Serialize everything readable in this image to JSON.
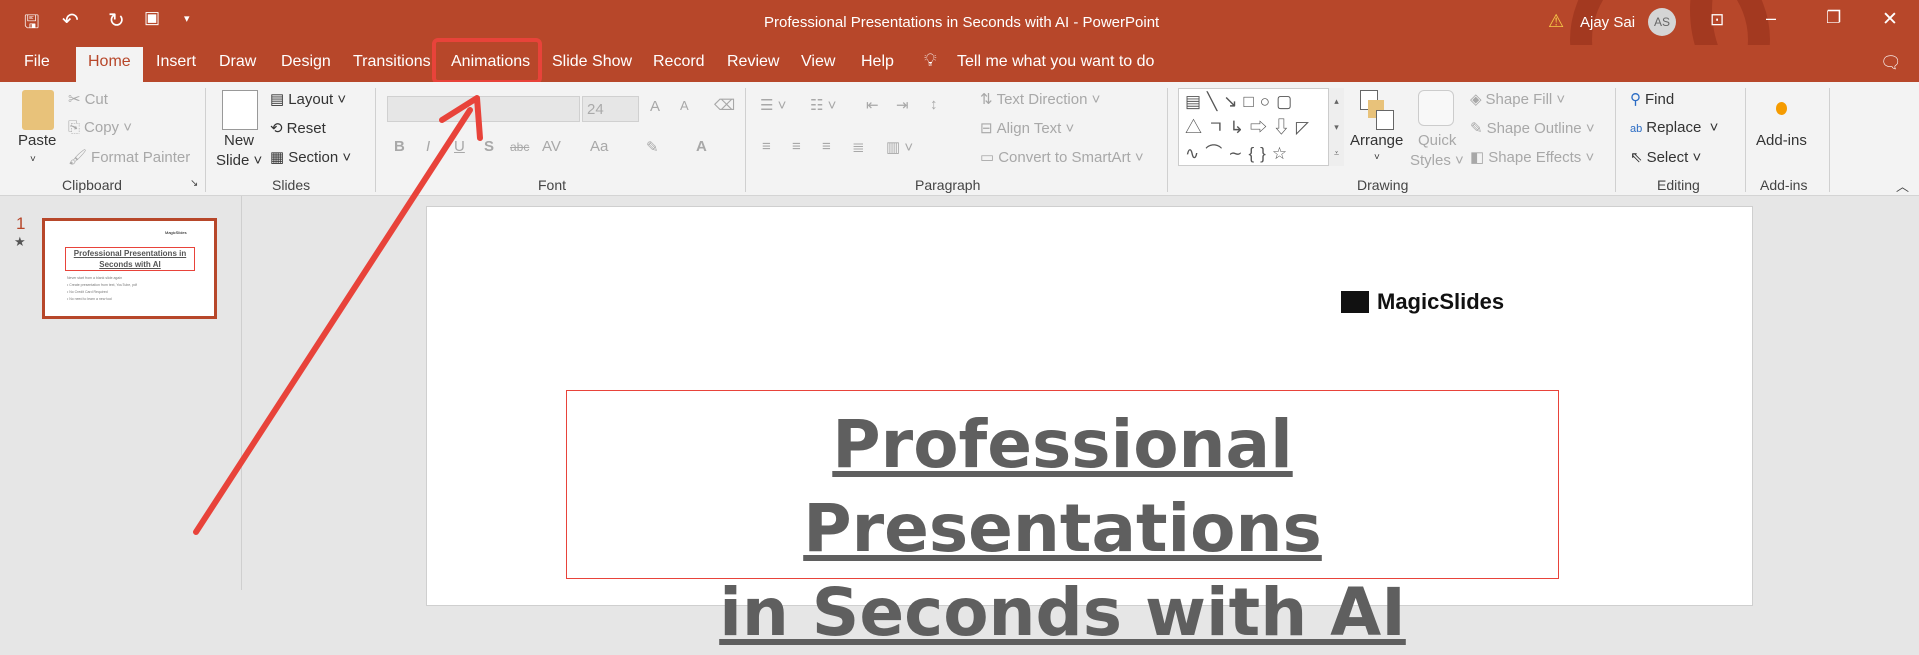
{
  "window": {
    "title": "Professional Presentations in Seconds with AI  -  PowerPoint",
    "user": "Ajay Sai",
    "avatar_initials": "AS"
  },
  "tabs": [
    "File",
    "Home",
    "Insert",
    "Draw",
    "Design",
    "Transitions",
    "Animations",
    "Slide Show",
    "Record",
    "Review",
    "View",
    "Help"
  ],
  "tell_me": "Tell me what you want to do",
  "ribbon": {
    "clipboard": {
      "paste": "Paste",
      "cut": "Cut",
      "copy": "Copy",
      "format_painter": "Format Painter",
      "label": "Clipboard"
    },
    "slides": {
      "new_slide_1": "New",
      "new_slide_2": "Slide",
      "layout": "Layout",
      "reset": "Reset",
      "section": "Section",
      "label": "Slides"
    },
    "font": {
      "size": "24",
      "bold": "B",
      "italic": "I",
      "underline": "U",
      "shadow": "S",
      "strike": "abc",
      "spacing": "AV",
      "case": "Aa",
      "color": "A",
      "grow": "A",
      "shrink": "A",
      "label": "Font"
    },
    "paragraph": {
      "text_direction": "Text Direction",
      "align_text": "Align Text",
      "smartart": "Convert to SmartArt",
      "label": "Paragraph"
    },
    "drawing": {
      "arrange": "Arrange",
      "quick_styles_1": "Quick",
      "quick_styles_2": "Styles",
      "shape_fill": "Shape Fill",
      "shape_outline": "Shape Outline",
      "shape_effects": "Shape Effects",
      "label": "Drawing"
    },
    "editing": {
      "find": "Find",
      "replace": "Replace",
      "select": "Select",
      "label": "Editing"
    },
    "addins": {
      "button": "Add-ins",
      "label": "Add-ins"
    }
  },
  "thumbnail": {
    "number": "1",
    "title": "Professional Presentations in Seconds with AI",
    "logo": "MagicSlides",
    "lines": [
      "Never start from a blank slide again",
      "• Create presentation from text, YouTube, pdf",
      "• No Credit Card Required",
      "• No need to learn a new tool"
    ]
  },
  "slide": {
    "logo": "MagicSlides",
    "title_line1": "Professional Presentations",
    "title_line2": "in Seconds with AI"
  },
  "colors": {
    "accent": "#b7472a",
    "highlight": "#e8433a"
  }
}
